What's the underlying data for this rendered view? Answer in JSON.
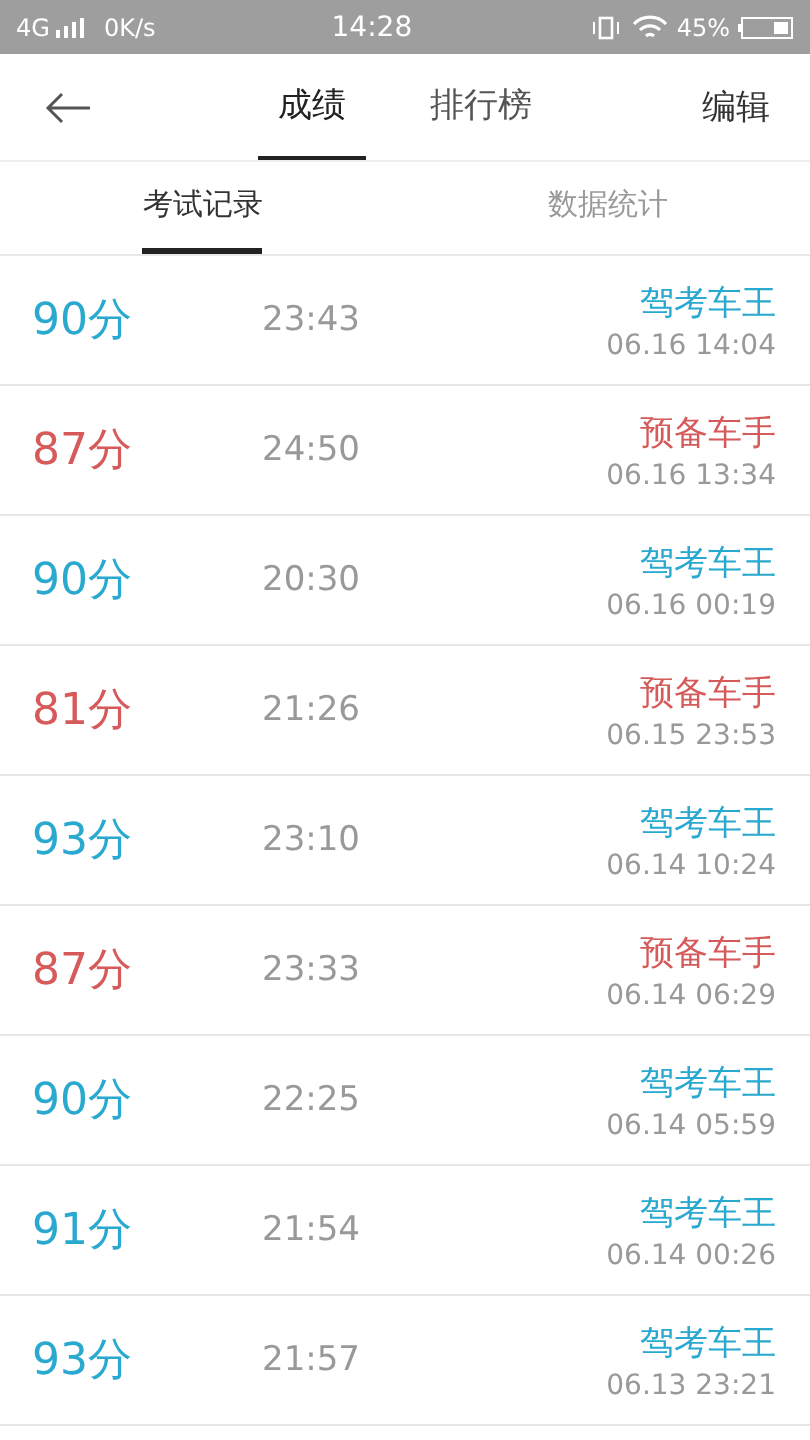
{
  "status_bar": {
    "network": "4G",
    "speed": "0K/s",
    "time": "14:28",
    "battery": "45%"
  },
  "header": {
    "tabs": [
      {
        "label": "成绩",
        "selected": true
      },
      {
        "label": "排行榜",
        "selected": false
      }
    ],
    "action": "编辑"
  },
  "sub_tabs": [
    {
      "label": "考试记录",
      "selected": true
    },
    {
      "label": "数据统计",
      "selected": false
    }
  ],
  "records": [
    {
      "score": "90分",
      "duration": "23:43",
      "title": "驾考车王",
      "date": "06.16 14:04",
      "passed": true
    },
    {
      "score": "87分",
      "duration": "24:50",
      "title": "预备车手",
      "date": "06.16 13:34",
      "passed": false
    },
    {
      "score": "90分",
      "duration": "20:30",
      "title": "驾考车王",
      "date": "06.16 00:19",
      "passed": true
    },
    {
      "score": "81分",
      "duration": "21:26",
      "title": "预备车手",
      "date": "06.15 23:53",
      "passed": false
    },
    {
      "score": "93分",
      "duration": "23:10",
      "title": "驾考车王",
      "date": "06.14 10:24",
      "passed": true
    },
    {
      "score": "87分",
      "duration": "23:33",
      "title": "预备车手",
      "date": "06.14 06:29",
      "passed": false
    },
    {
      "score": "90分",
      "duration": "22:25",
      "title": "驾考车王",
      "date": "06.14 05:59",
      "passed": true
    },
    {
      "score": "91分",
      "duration": "21:54",
      "title": "驾考车王",
      "date": "06.14 00:26",
      "passed": true
    },
    {
      "score": "93分",
      "duration": "21:57",
      "title": "驾考车王",
      "date": "06.13 23:21",
      "passed": true
    }
  ]
}
